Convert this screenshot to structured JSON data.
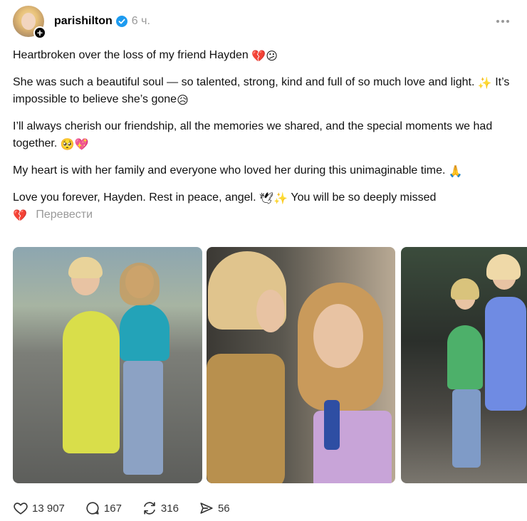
{
  "post": {
    "username": "parishilton",
    "timestamp": "6 ч.",
    "paragraphs": [
      {
        "text": "Heartbroken over the loss of my friend Hayden",
        "emoji": "💔😕"
      },
      {
        "text": "She was such a beautiful soul — so talented, strong, kind and full of so much love and light.",
        "emoji_mid": "✨",
        "text2": "It’s impossible to believe she’s gone",
        "emoji": "😥"
      },
      {
        "text": "I’ll always cherish our friendship, all the memories we shared, and the special moments we had together.",
        "emoji": "🥺💖"
      },
      {
        "text": "My heart is with her family and everyone who loved her during this unimaginable time.",
        "emoji": "🙏"
      },
      {
        "text": "Love you forever, Hayden. Rest in peace, angel.",
        "emoji_mid": "🕊✨",
        "text2": "You will be so deeply missed",
        "emoji": "💔"
      }
    ],
    "translate_label": "Перевести"
  },
  "actions": {
    "likes": "13 907",
    "comments": "167",
    "reposts": "316",
    "shares": "56"
  },
  "icons": {
    "verified": "verified-badge-icon",
    "more": "more-options-icon",
    "like": "heart-icon",
    "comment": "comment-bubble-icon",
    "repost": "repost-icon",
    "share": "share-icon"
  },
  "colors": {
    "verified": "#1d9bf0",
    "muted": "#999999"
  }
}
